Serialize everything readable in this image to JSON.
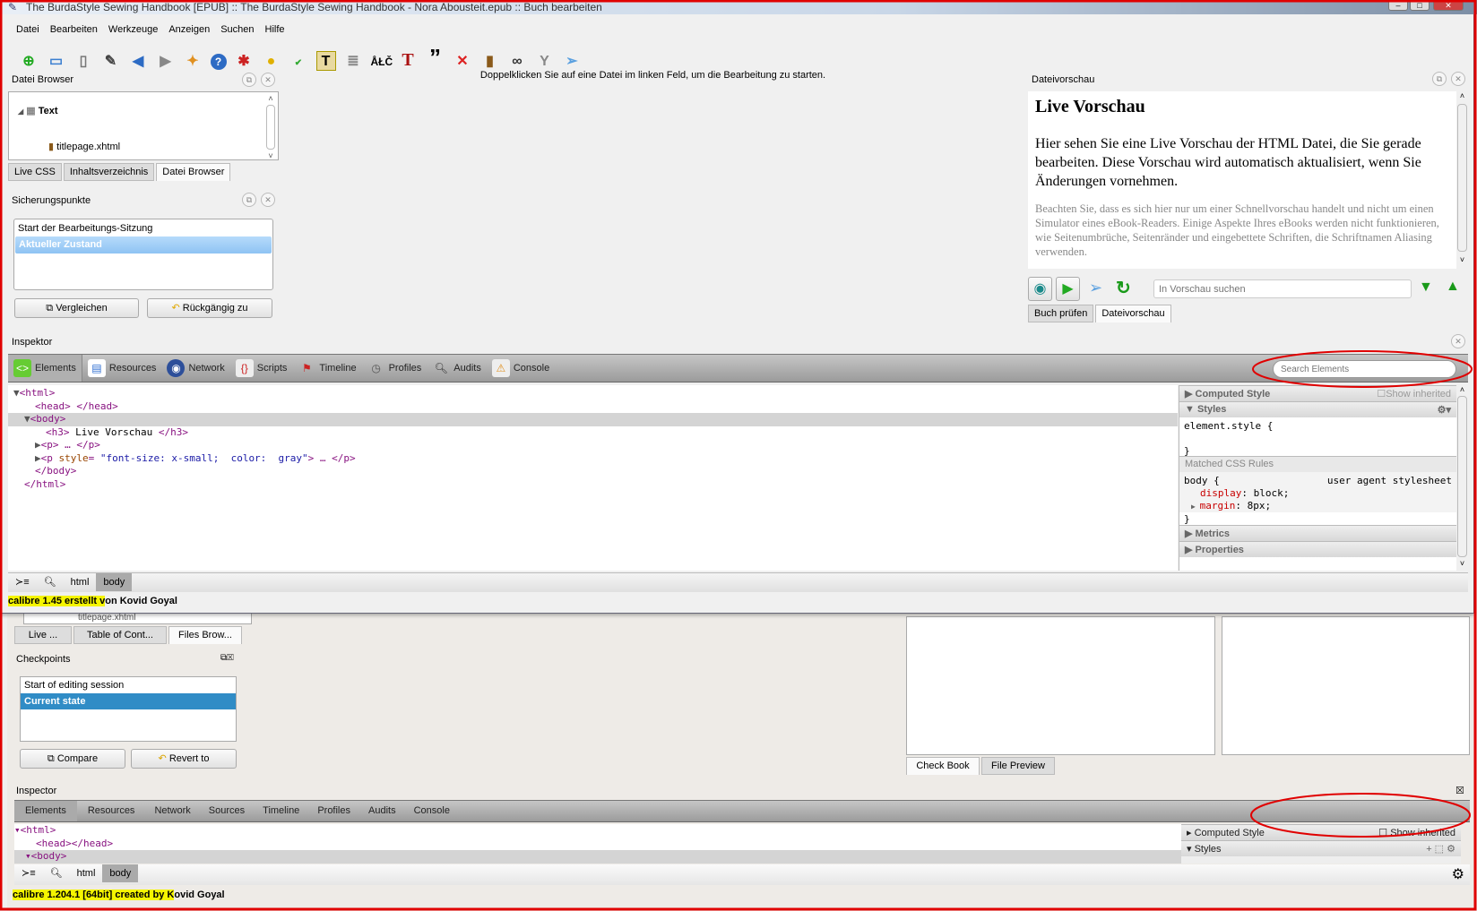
{
  "window": {
    "title": "The BurdaStyle Sewing Handbook [EPUB] :: The BurdaStyle Sewing Handbook - Nora Abousteit.epub :: Buch bearbeiten"
  },
  "menu": [
    "Datei",
    "Bearbeiten",
    "Werkzeuge",
    "Anzeigen",
    "Suchen",
    "Hilfe"
  ],
  "toolbar_icons": [
    "new-file-icon",
    "save-icon",
    "checkpoint-icon",
    "edit-icon",
    "back-icon",
    "forward-icon",
    "pin-icon",
    "help-icon",
    "debug-bug-icon",
    "spell-icon",
    "spellcheck-abc-icon",
    "text-icon",
    "document-icon",
    "character-icon",
    "font-icon",
    "quotes-icon",
    "remove-icon",
    "book-icon",
    "binoculars-icon",
    "funnel-icon",
    "send-icon"
  ],
  "center_hint": "Doppelklicken Sie auf eine Datei im linken Feld, um die Bearbeitung zu starten.",
  "file_browser": {
    "title": "Datei Browser",
    "folder": "Text",
    "file": "titlepage.xhtml",
    "tabs": [
      "Live CSS",
      "Inhaltsverzeichnis",
      "Datei Browser"
    ]
  },
  "checkpoints": {
    "title": "Sicherungspunkte",
    "items": [
      "Start der Bearbeitungs-Sitzung",
      "Aktueller Zustand"
    ],
    "compare": "Vergleichen",
    "revert": "Rückgängig zu"
  },
  "preview": {
    "title": "Dateivorschau",
    "heading": "Live Vorschau",
    "para1": "Hier sehen Sie eine Live Vorschau der HTML Datei, die Sie gerade bearbeiten. Diese Vorschau wird automatisch aktualisiert, wenn Sie Änderungen vornehmen.",
    "para2": "Beachten Sie, dass es sich hier nur um einer Schnellvorschau handelt und nicht um einen Simulator eines eBook-Readers. Einige Aspekte Ihres eBooks werden nicht funktionieren, wie Seitenumbrüche, Seitenränder und eingebettete Schriften, die Schriftnamen Aliasing verwenden.",
    "search_placeholder": "In Vorschau suchen",
    "tabs": [
      "Buch prüfen",
      "Dateivorschau"
    ]
  },
  "inspector": {
    "title": "Inspektor",
    "tabs": [
      "Elements",
      "Resources",
      "Network",
      "Scripts",
      "Timeline",
      "Profiles",
      "Audits",
      "Console"
    ],
    "search_placeholder": "Search Elements",
    "dom": {
      "l1": "<html>",
      "l2": "<head> </head>",
      "l3": "<body>",
      "l4a": "<h3>",
      "l4b": " Live Vorschau ",
      "l4c": "</h3>",
      "l5": "<p> … </p>",
      "l6a": "<p ",
      "l6b": "style",
      "l6c": "= ",
      "l6d": "\"font-size: x-small;  color:  gray\"",
      "l6e": "> … </p>",
      "l7": "</body>",
      "l8": "</html>"
    },
    "sidebar": {
      "computed": "Computed Style",
      "show_inherited": "Show inherited",
      "styles": "Styles",
      "element_style": "element.style {",
      "close_brace": "}",
      "matched": "Matched CSS Rules",
      "body_rule": "body {",
      "ua": "user agent stylesheet",
      "prop1": "display",
      "val1": ": block;",
      "prop2": "margin",
      "val2": ": 8px;",
      "metrics": "Metrics",
      "properties": "Properties"
    },
    "breadcrumb": [
      "html",
      "body"
    ]
  },
  "status": {
    "highlight": "calibre 1.45 erstellt v",
    "rest": "on Kovid Goyal"
  },
  "bg": {
    "file": "titlepage.xhtml",
    "tabs": [
      "Live ...",
      "Table of Cont...",
      "Files Brow..."
    ],
    "checkpoints_title": "Checkpoints",
    "items": [
      "Start of editing session",
      "Current state"
    ],
    "compare": "Compare",
    "revert": "Revert to",
    "tabs_right": [
      "Check Book",
      "File Preview"
    ],
    "inspector_title": "Inspector",
    "itabs": [
      "Elements",
      "Resources",
      "Network",
      "Sources",
      "Timeline",
      "Profiles",
      "Audits",
      "Console"
    ],
    "dom": [
      "<html>",
      "<head></head>",
      "<body>"
    ],
    "computed": "Computed Style",
    "show_inherited": "Show inherited",
    "styles": "Styles",
    "breadcrumb": [
      "html",
      "body"
    ],
    "status_highlight": "calibre 1.204.1 [64bit] created by K",
    "status_rest": "ovid Goyal"
  },
  "colors": {
    "selection": "#9fcbf5",
    "bg_selection": "#308cc6",
    "annotation": "#e00000",
    "highlight": "#f5f500"
  }
}
